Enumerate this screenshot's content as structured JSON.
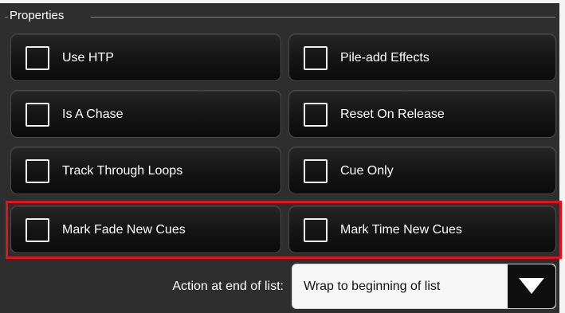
{
  "properties": {
    "title": "Properties",
    "options": [
      {
        "label": "Use HTP",
        "checked": false
      },
      {
        "label": "Pile-add Effects",
        "checked": false
      },
      {
        "label": "Is A Chase",
        "checked": false
      },
      {
        "label": "Reset On Release",
        "checked": false
      },
      {
        "label": "Track Through Loops",
        "checked": false
      },
      {
        "label": "Cue Only",
        "checked": false
      },
      {
        "label": "Mark Fade New Cues",
        "checked": false
      },
      {
        "label": "Mark Time New Cues",
        "checked": false
      }
    ]
  },
  "action_at_end": {
    "label": "Action at end of list:",
    "selected": "Wrap to beginning of list"
  },
  "colors": {
    "panel": "#2e2e2e",
    "highlight": "#e5121c"
  },
  "icons": {
    "checkbox": "checkbox-unchecked-icon",
    "dropdown": "chevron-down-icon"
  }
}
